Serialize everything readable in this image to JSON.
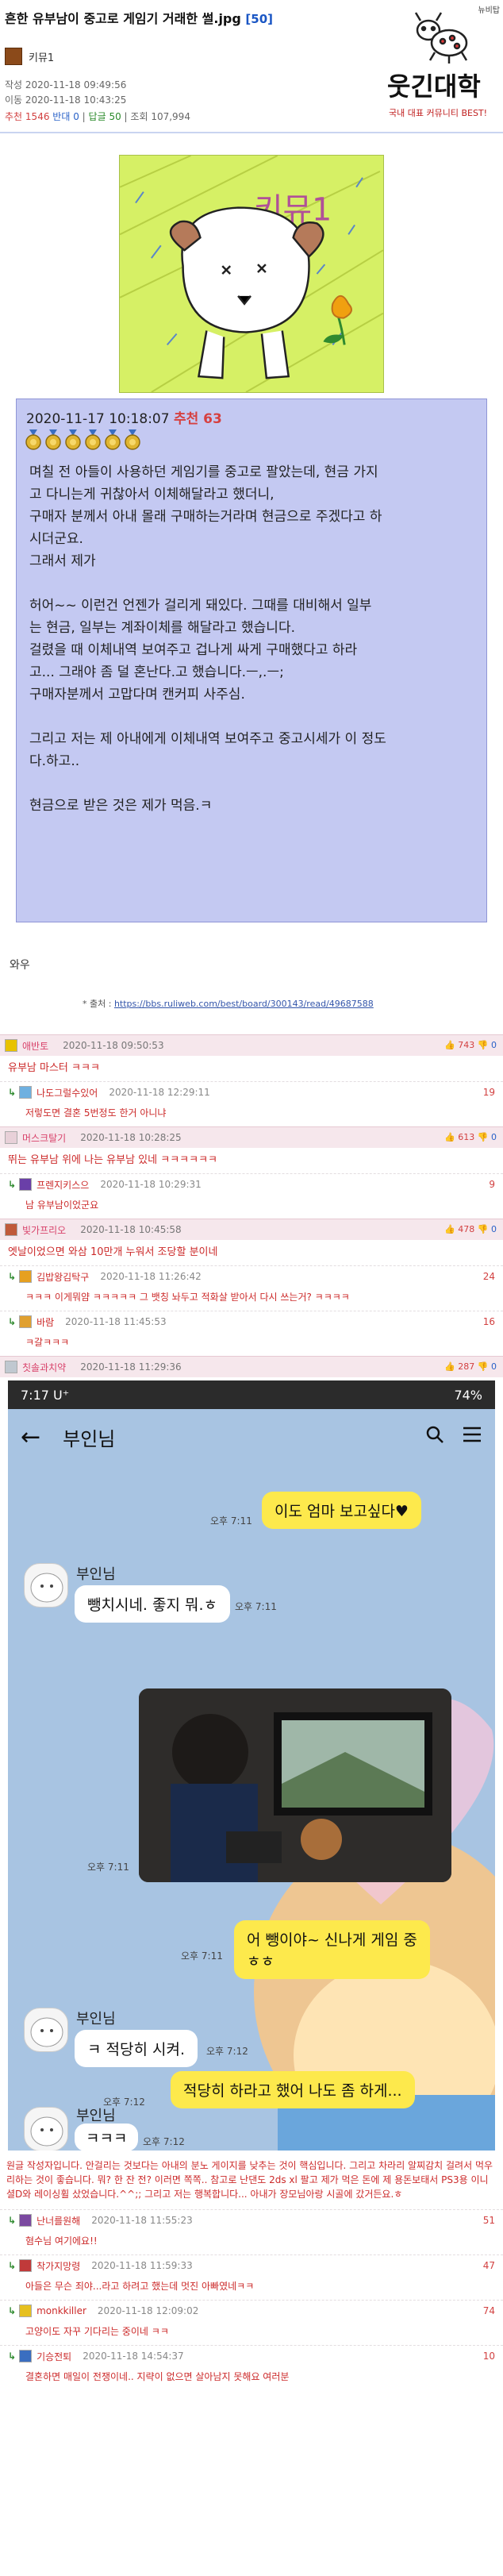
{
  "header": {
    "title": "흔한 유부남이 중고로 게임기 거래한 썰.jpg",
    "comment_count": "[50]",
    "top_right_small": "뉴비탑",
    "author": "키뮤1",
    "created": "작성 2020-11-18 09:49:56",
    "moved": "이동 2020-11-18 10:43:25",
    "stats": {
      "rec_label": "추천",
      "rec": "1546",
      "ban_label": "반대",
      "ban": "0",
      "dap_label": "답글",
      "dap": "50",
      "views_label": "조회",
      "views": "107,994"
    },
    "logo_text": "웃긴대학",
    "logo_sub": "국내 대표 커뮤니티 BEST!"
  },
  "drawing": {
    "caption": "키뮤1"
  },
  "quote": {
    "date": "2020-11-17 10:18:07",
    "rec_label": "추천 63",
    "body": "며칠 전 아들이 사용하던 게임기를 중고로 팔았는데, 현금 가지\n고 다니는게 귀찮아서 이체해달라고 했더니,\n구매자 분께서 아내 몰래 구매하는거라며 현금으로 주겠다고 하\n시더군요.\n그래서 제가\n\n허어~~ 이런건 언젠가 걸리게 돼있다. 그때를 대비해서 일부\n는 현금, 일부는 계좌이체를 해달라고 했습니다.\n걸렸을 때 이체내역 보여주고 겁나게 싸게 구매했다고 하라\n고... 그래야 좀 덜 혼난다.고 했습니다.ㅡ,.ㅡ;\n구매자분께서 고맙다며 캔커피 사주심.\n\n그리고 저는 제 아내에게 이체내역 보여주고 중고시세가 이 정도\n다.하고..\n\n현금으로 받은 것은 제가 먹음.ㅋ"
  },
  "after_quote": {
    "wow": "와우",
    "source_label": "* 출처 :",
    "source_url": "https://bbs.ruliweb.com/best/board/300143/read/49687588"
  },
  "comments": [
    {
      "user": "애반토",
      "time": "2020-11-18 09:50:53",
      "up": "743",
      "down": "0",
      "text": "유부남 마스터 ㅋㅋㅋ",
      "replies": [
        {
          "user": "나도그럴수있어",
          "time": "2020-11-18 12:29:11",
          "num": "19",
          "text": "저렇도면 결혼 5번정도 한거 아니냐"
        }
      ]
    },
    {
      "user": "머스크탈기",
      "time": "2020-11-18 10:28:25",
      "up": "613",
      "down": "0",
      "text": "뛰는 유부남 위에 나는 유부남 있네 ㅋㅋㅋㅋㅋㅋ",
      "replies": [
        {
          "user": "프렌지키스으",
          "time": "2020-11-18 10:29:31",
          "num": "9",
          "text": "남 유부남이었군요"
        }
      ]
    },
    {
      "user": "빛가프리오",
      "time": "2020-11-18 10:45:58",
      "up": "478",
      "down": "0",
      "text": "엣날이었으면 와삼 10만개 누워서 조당할 분이네",
      "replies": [
        {
          "user": "김밥왕김탁구",
          "time": "2020-11-18 11:26:42",
          "num": "24",
          "text": "ㅋㅋㅋ 이게뭐얌 ㅋㅋㅋㅋㅋ 그 뱃칭 놔두고 적화살 받아서 다시 쓰는거? ㅋㅋㅋㅋ"
        },
        {
          "user": "바람",
          "time": "2020-11-18 11:45:53",
          "num": "16",
          "text": "ㅋ갈ㅋㅋㅋ"
        }
      ]
    },
    {
      "user": "칫솔과치약",
      "time": "2020-11-18 11:29:36",
      "up": "287",
      "down": "0",
      "text": ""
    }
  ],
  "phone": {
    "time": "7:17",
    "carrier": "U⁺",
    "battery": "74%",
    "chat_title": "부인님",
    "search_icon": "search-icon",
    "menu_icon": "menu-icon",
    "msg1": "이도 엄마 보고싶다♥",
    "msg1_time": "오후 7:11",
    "sender": "부인님",
    "msg2": "뺑치시네. 좋지 뭐.ㅎ",
    "msg2_time": "오후 7:11",
    "photo_time": "오후 7:11",
    "msg3": "어 뺑이야~ 신나게 게임 중\nㅎㅎ",
    "msg3_time": "오후 7:11",
    "msg4": "ㅋ 적당히 시켜.",
    "msg4_time": "오후 7:12",
    "msg5": "적당히 하라고 했어 나도 좀 하게...",
    "msg5_time": "오후 7:12",
    "msg6": "ㅋㅋㅋ",
    "msg6_time": "오후 7:12"
  },
  "post_phone_text": "원글 작성자입니다. 안걸리는 것보다는 아내의 분노 게이지를 낮추는 것이 핵심입니다. 그리고 차라리 알찌감치 걸려서 먹우리하는 것이 좋습니다. 뭐? 한 잔 전? 이러면 쪽쪽.. 참고로 난댄도 2ds xl 팔고 제가 먹은 돈에 제 용돈보태서 PS3용 이니셜D와 레이싱휠 샀었습니다.^^;; 그리고 저는 행복합니다... 아내가 장모님아랑 시골에 갔거든요.ㅎ",
  "late_replies": [
    {
      "user": "난너를원해",
      "time": "2020-11-18 11:55:23",
      "num": "51",
      "text": "혐수님 여기에요!!"
    },
    {
      "user": "착가지망령",
      "time": "2020-11-18 11:59:33",
      "num": "47",
      "text": "아들은 무슨 죄야...라고 하려고 했는데 멋진 아빠였네ㅋㅋ"
    },
    {
      "user": "monkkiller",
      "time": "2020-11-18 12:09:02",
      "num": "74",
      "text": "고양이도 자꾸 기다리는 중이네 ㅋㅋ"
    },
    {
      "user": "기승전퇴",
      "time": "2020-11-18 14:54:37",
      "num": "10",
      "text": "결혼하면 매일이 전쟁이네.. 지략이 없으면 살아남지 못해요 여러분"
    }
  ],
  "colors": {
    "accent_red": "#d24040",
    "accent_blue": "#2a62c8",
    "quote_bg": "#c4c9f2",
    "comment_head_bg": "#f6e7ec"
  }
}
